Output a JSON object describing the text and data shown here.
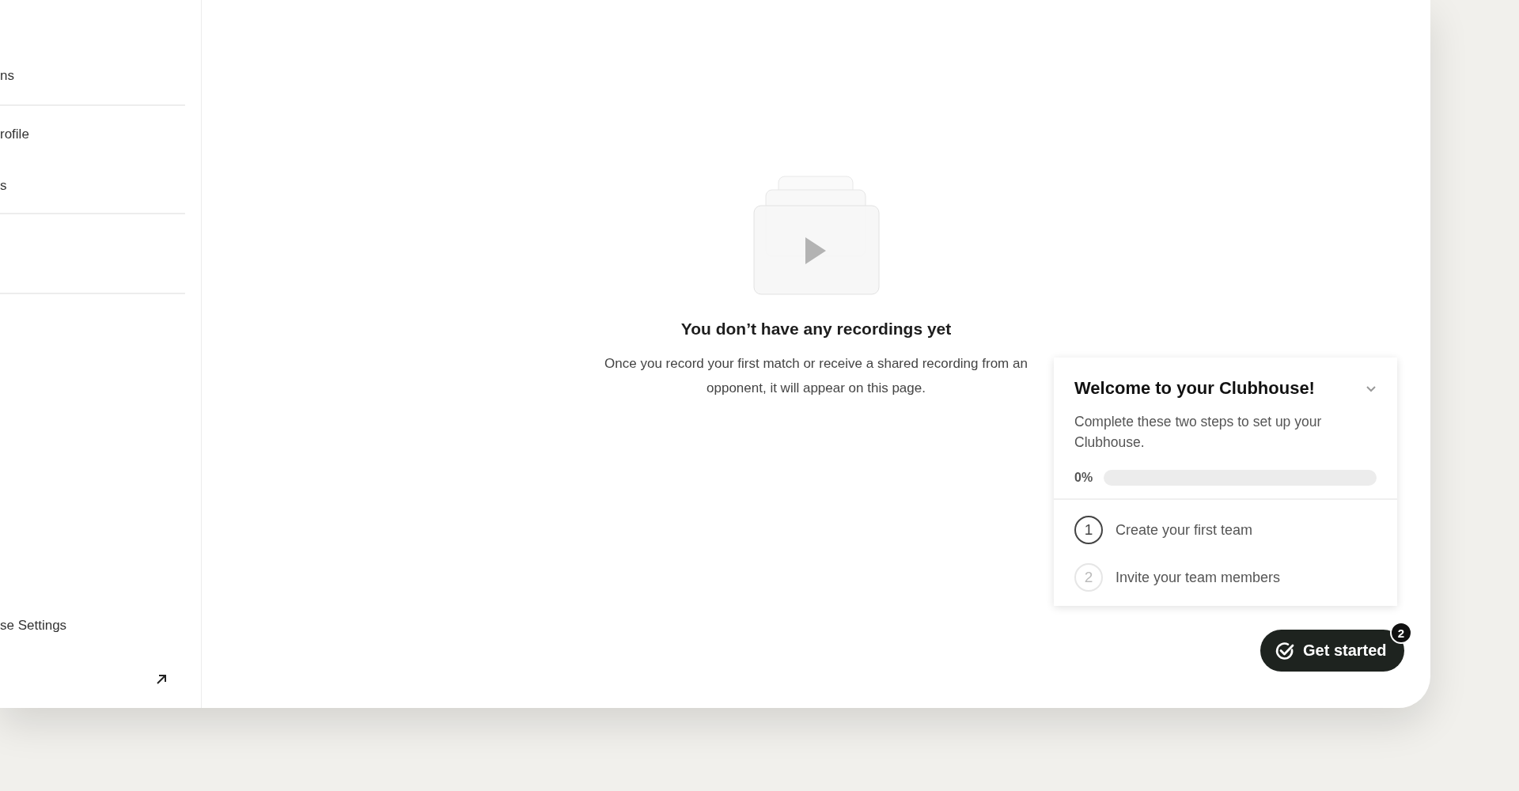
{
  "sidebar": {
    "groups": [
      {
        "items": [
          "ns"
        ]
      },
      {
        "items": [
          "rofile",
          "s"
        ]
      },
      {
        "items": [
          "se Settings"
        ]
      }
    ]
  },
  "empty_state": {
    "title": "You don’t have any recordings yet",
    "message": "Once you record your first match or receive a shared recording from an opponent, it will appear on this page."
  },
  "onboarding": {
    "title": "Welcome to your Clubhouse!",
    "expanded": true,
    "description": "Complete these two steps to set up your Clubhouse.",
    "progress_label": "0%",
    "level": 0,
    "steps": [
      {
        "number": "1",
        "label": "Create your first team",
        "active": true
      },
      {
        "number": "2",
        "label": "Invite your team members",
        "active": false
      }
    ]
  },
  "get_started": {
    "label": "Get started",
    "badge": "2"
  }
}
